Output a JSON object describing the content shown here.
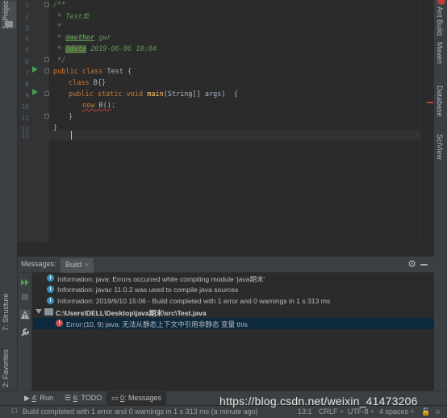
{
  "left_strip": {
    "project_tab": "1: Project",
    "structure_tab": "7: Structure",
    "favorites_tab": "2: Favorites"
  },
  "right_bar": {
    "tabs": [
      "Ant Build",
      "Maven",
      "Database",
      "SciView"
    ]
  },
  "editor": {
    "line_numbers": [
      "1",
      "2",
      "3",
      "4",
      "5",
      "6",
      "7",
      "8",
      "9",
      "10",
      "11",
      "12",
      "13"
    ],
    "lines": {
      "l1": "/**",
      "l2_prefix": " * ",
      "l2_text": "Test类",
      "l3": " *",
      "l4_prefix": " * ",
      "l4_tag": "@author",
      "l4_val": " gwr",
      "l5_prefix": " * ",
      "l5_tag": "@date",
      "l5_val": " 2019-06-06 10:04",
      "l6": " */",
      "l7_kw": "public class",
      "l7_rest": " Test {",
      "l8_kw": "class",
      "l8_name": " B",
      "l8_rest": "{}",
      "l9_kw": "public static void",
      "l9_fn": " main",
      "l9_rest": "(String[] args)  {",
      "l10_kw": "new",
      "l10_rest": " B()",
      "l10_end": ";",
      "l11": "}",
      "l12": "}",
      "l13": ""
    }
  },
  "toolwindow": {
    "title": "Messages:",
    "tab": "Build",
    "tab_close": "×",
    "messages": [
      {
        "kind": "info",
        "text": "Information: java: Errors occurred while compiling module 'java期末'"
      },
      {
        "kind": "info",
        "text": "Information: javac 11.0.2 was used to compile java sources"
      },
      {
        "kind": "info",
        "text": "Information: 2019/6/10 15:06 - Build completed with 1 error and 0 warnings in 1 s 313 ms"
      },
      {
        "kind": "file",
        "text": "C:\\Users\\DELL\\Desktop\\java期末\\src\\Test.java"
      },
      {
        "kind": "error",
        "text": "Error:(10, 9)  java: 无法从静态上下文中引用非静态 变量 this"
      }
    ]
  },
  "bottom_tabs": {
    "run_num": "4",
    "run_label": ": Run",
    "todo_num": "6",
    "todo_label": ": TODO",
    "messages_num": "0",
    "messages_label": ": Messages"
  },
  "statusbar": {
    "message": "Build completed with 1 error and 0 warnings in 1 s 313 ms (a minute ago)",
    "position": "13:1",
    "line_sep": "CRLF ÷",
    "encoding": "UTF-8 ÷",
    "indent": "4 spaces ÷"
  },
  "watermark": "https://blog.csdn.net/weixin_41473206",
  "colors": {
    "background": "#2b2b2b",
    "panel": "#3c3f41",
    "comment": "#629755",
    "keyword": "#cc7832",
    "method": "#ffc66d",
    "error": "#bc3f3c",
    "run_green": "#499c54",
    "info_blue": "#3592c4",
    "selection": "#0d293e"
  }
}
